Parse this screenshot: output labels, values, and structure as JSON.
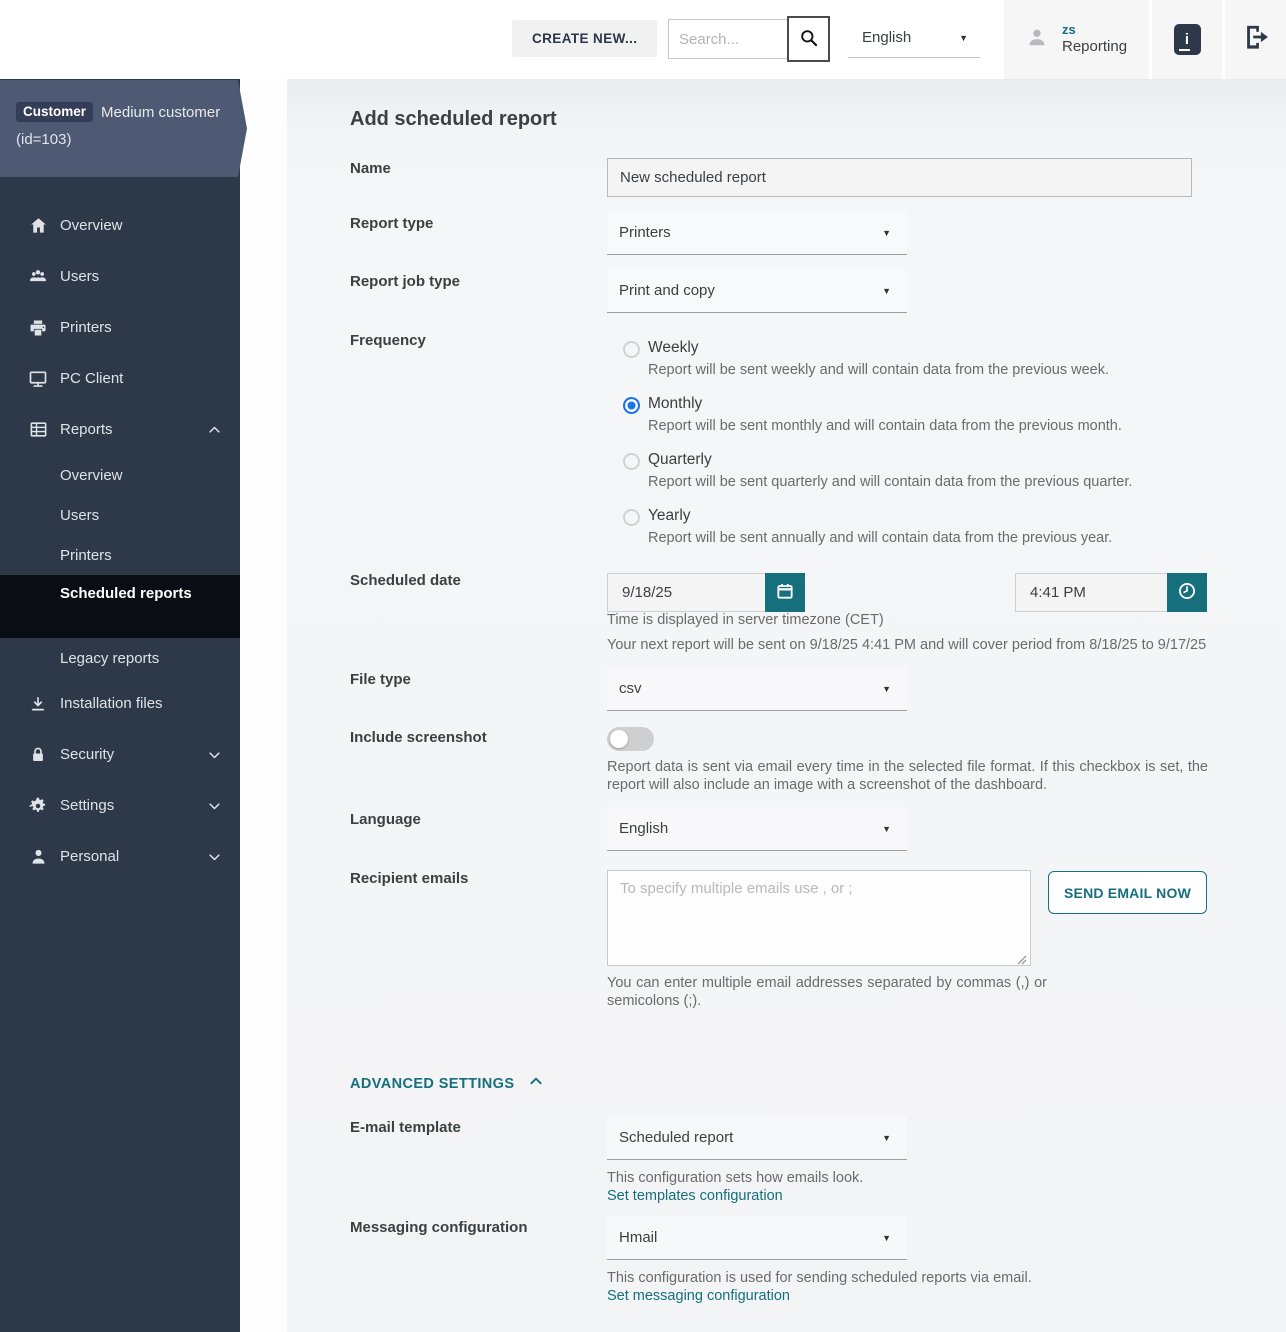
{
  "colors": {
    "accent_teal": "#156f7c",
    "radio_blue": "#1a73e8",
    "sidebar_bg": "#2d3848",
    "banner_bg": "#4e5a73",
    "active_item_bg": "#0a0e14"
  },
  "header": {
    "create_new_label": "CREATE NEW...",
    "search_placeholder": "Search...",
    "language_value": "English",
    "user_initials": "zs",
    "user_name": "Reporting"
  },
  "sidebar": {
    "customer": {
      "badge": "Customer",
      "name": "Medium customer",
      "id": "(id=103)"
    },
    "items": [
      {
        "label": "Overview",
        "icon": "home"
      },
      {
        "label": "Users",
        "icon": "users-group"
      },
      {
        "label": "Printers",
        "icon": "printer"
      },
      {
        "label": "PC Client",
        "icon": "monitor"
      },
      {
        "label": "Reports",
        "icon": "report-table",
        "expanded": true
      }
    ],
    "reports_subitems": [
      {
        "label": "Overview"
      },
      {
        "label": "Users"
      },
      {
        "label": "Printers"
      },
      {
        "label": "Scheduled reports",
        "active": true
      },
      {
        "label": "Legacy reports"
      }
    ],
    "items_lower": [
      {
        "label": "Installation files",
        "icon": "download"
      },
      {
        "label": "Security",
        "icon": "lock",
        "collapsed": true
      },
      {
        "label": "Settings",
        "icon": "gear",
        "collapsed": true
      },
      {
        "label": "Personal",
        "icon": "person",
        "collapsed": true
      }
    ]
  },
  "form": {
    "title": "Add scheduled report",
    "name": {
      "label": "Name",
      "value": "New scheduled report"
    },
    "report_type": {
      "label": "Report type",
      "value": "Printers"
    },
    "report_job_type": {
      "label": "Report job type",
      "value": "Print and copy"
    },
    "frequency": {
      "label": "Frequency",
      "selected": "Monthly",
      "options": [
        {
          "label": "Weekly",
          "description": "Report will be sent weekly and will contain data from the previous week."
        },
        {
          "label": "Monthly",
          "description": "Report will be sent monthly and will contain data from the previous month."
        },
        {
          "label": "Quarterly",
          "description": "Report will be sent quarterly and will contain data from the previous quarter."
        },
        {
          "label": "Yearly",
          "description": "Report will be sent annually and will contain data from the previous year."
        }
      ]
    },
    "scheduled_date": {
      "label": "Scheduled date",
      "date_value": "9/18/25",
      "time_value": "4:41 PM",
      "timezone_note": "Time is displayed in server timezone (CET)",
      "next_report_note": "Your next report will be sent on 9/18/25 4:41 PM and will cover period from 8/18/25 to 9/17/25"
    },
    "file_type": {
      "label": "File type",
      "value": "csv"
    },
    "include_screenshot": {
      "label": "Include screenshot",
      "enabled": false,
      "description": "Report data is sent via email every time in the selected file format. If this checkbox is set, the report will also include an image with a screenshot of the dashboard."
    },
    "language": {
      "label": "Language",
      "value": "English"
    },
    "recipient_emails": {
      "label": "Recipient emails",
      "placeholder": "To specify multiple emails use , or ;",
      "send_button_label": "SEND EMAIL NOW",
      "helper": "You can enter multiple email addresses separated by commas (,) or semicolons (;)."
    },
    "advanced_settings_label": "ADVANCED SETTINGS",
    "email_template": {
      "label": "E-mail template",
      "value": "Scheduled report",
      "helper": "This configuration sets how emails look.",
      "link_label": "Set templates configuration"
    },
    "messaging_configuration": {
      "label": "Messaging configuration",
      "value": "Hmail",
      "helper": "This configuration is used for sending scheduled reports via email.",
      "link_label": "Set messaging configuration"
    }
  }
}
